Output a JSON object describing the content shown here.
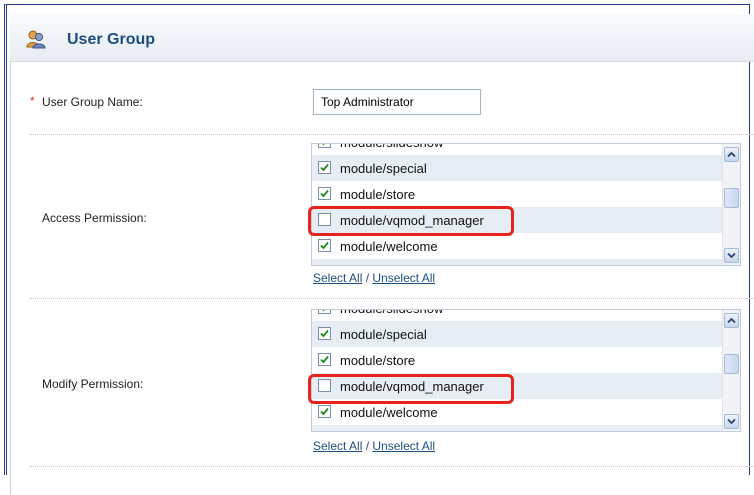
{
  "heading": {
    "title": "User Group"
  },
  "form": {
    "required_mark": "*",
    "name_label": "User Group Name:",
    "name_value": "Top Administrator",
    "access_label": "Access Permission:",
    "modify_label": "Modify Permission:"
  },
  "access": {
    "items": [
      {
        "label": "module/slideshow",
        "checked": true
      },
      {
        "label": "module/special",
        "checked": true
      },
      {
        "label": "module/store",
        "checked": true
      },
      {
        "label": "module/vqmod_manager",
        "checked": false
      },
      {
        "label": "module/welcome",
        "checked": true
      },
      {
        "label": "",
        "checked": false
      }
    ],
    "select_all": "Select All",
    "divider": "/",
    "unselect_all": "Unselect All"
  },
  "modify": {
    "items": [
      {
        "label": "module/slideshow",
        "checked": true
      },
      {
        "label": "module/special",
        "checked": true
      },
      {
        "label": "module/store",
        "checked": true
      },
      {
        "label": "module/vqmod_manager",
        "checked": false
      },
      {
        "label": "module/welcome",
        "checked": true
      },
      {
        "label": "",
        "checked": false
      }
    ],
    "select_all": "Select All",
    "divider": "/",
    "unselect_all": "Unselect All"
  },
  "colors": {
    "accent": "#1d4e80",
    "highlight": "#e8231b",
    "row_alt": "#e6edf5"
  }
}
